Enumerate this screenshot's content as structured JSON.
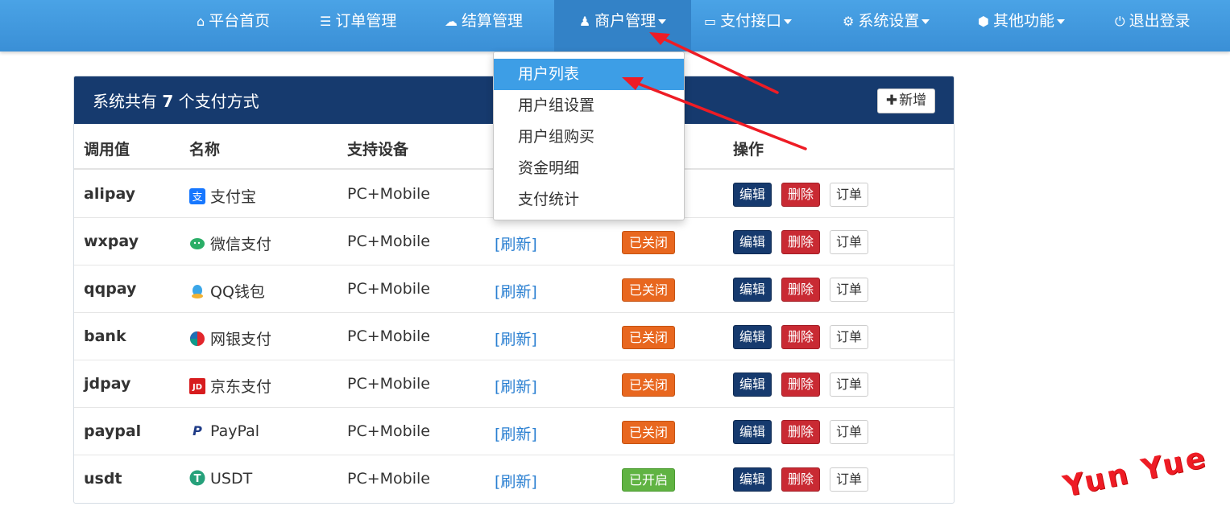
{
  "nav": {
    "items": [
      {
        "label": "平台首页",
        "icon": "home-icon",
        "glyph": "⌂"
      },
      {
        "label": "订单管理",
        "icon": "list-icon",
        "glyph": "☰"
      },
      {
        "label": "结算管理",
        "icon": "cloud-icon",
        "glyph": "☁"
      },
      {
        "label": "商户管理",
        "icon": "user-icon",
        "glyph": "♟"
      },
      {
        "label": "支付接口",
        "icon": "card-icon",
        "glyph": "▭"
      },
      {
        "label": "系统设置",
        "icon": "gear-icon",
        "glyph": "⚙"
      },
      {
        "label": "其他功能",
        "icon": "cube-icon",
        "glyph": "⬢"
      },
      {
        "label": "退出登录",
        "icon": "power-icon",
        "glyph": "⏻"
      }
    ]
  },
  "dropdown": {
    "items": [
      "用户列表",
      "用户组设置",
      "用户组购买",
      "资金明细",
      "支付统计"
    ]
  },
  "panel": {
    "title_prefix": "系统共有",
    "count": "7",
    "title_suffix": "个支付方式",
    "add_label": "新增"
  },
  "table": {
    "headers": [
      "调用值",
      "名称",
      "支持设备",
      "操作"
    ],
    "rows": [
      {
        "code": "alipay",
        "name": "支付宝",
        "device": "PC+Mobile",
        "refresh": "",
        "status": "",
        "icon": "alipay-icon"
      },
      {
        "code": "wxpay",
        "name": "微信支付",
        "device": "PC+Mobile",
        "refresh": "[刷新]",
        "status": "已关闭",
        "icon": "wechat-icon"
      },
      {
        "code": "qqpay",
        "name": "QQ钱包",
        "device": "PC+Mobile",
        "refresh": "[刷新]",
        "status": "已关闭",
        "icon": "qq-icon"
      },
      {
        "code": "bank",
        "name": "网银支付",
        "device": "PC+Mobile",
        "refresh": "[刷新]",
        "status": "已关闭",
        "icon": "unionpay-icon"
      },
      {
        "code": "jdpay",
        "name": "京东支付",
        "device": "PC+Mobile",
        "refresh": "[刷新]",
        "status": "已关闭",
        "icon": "jd-icon"
      },
      {
        "code": "paypal",
        "name": "PayPal",
        "device": "PC+Mobile",
        "refresh": "[刷新]",
        "status": "已关闭",
        "icon": "paypal-icon"
      },
      {
        "code": "usdt",
        "name": "USDT",
        "device": "PC+Mobile",
        "refresh": "[刷新]",
        "status": "已开启",
        "icon": "tether-icon"
      }
    ],
    "actions": {
      "edit": "编辑",
      "delete": "删除",
      "orders": "订单"
    }
  },
  "watermark": "Yun Yue",
  "colors": {
    "nav": "#3a8fd6",
    "panel_head": "#163a6e",
    "off": "#e8671f",
    "on": "#60b342",
    "delete": "#c92a33",
    "arrow": "#ee1c25"
  }
}
